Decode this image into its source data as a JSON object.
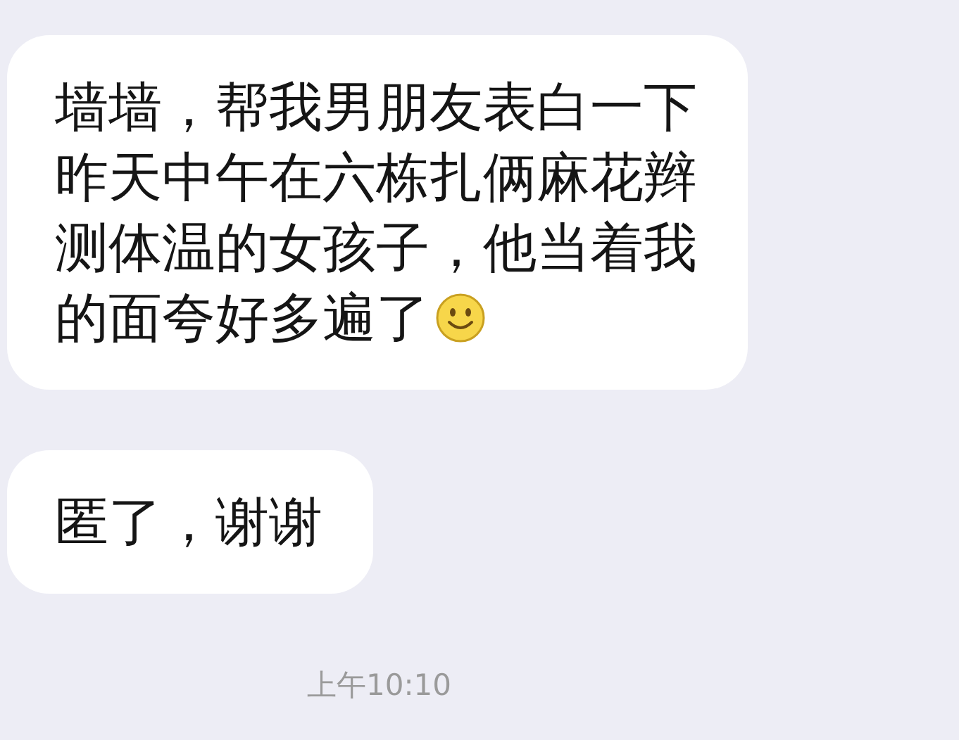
{
  "messages": [
    {
      "lines": [
        "墙墙，帮我男朋友表白一下",
        "昨天中午在六栋扎俩麻花辫",
        "测体温的女孩子，他当着我",
        "的面夸好多遍了"
      ],
      "trailing_emoji": true
    },
    {
      "lines": [
        "匿了，谢谢"
      ],
      "trailing_emoji": false
    }
  ],
  "timestamp": "上午10:10"
}
